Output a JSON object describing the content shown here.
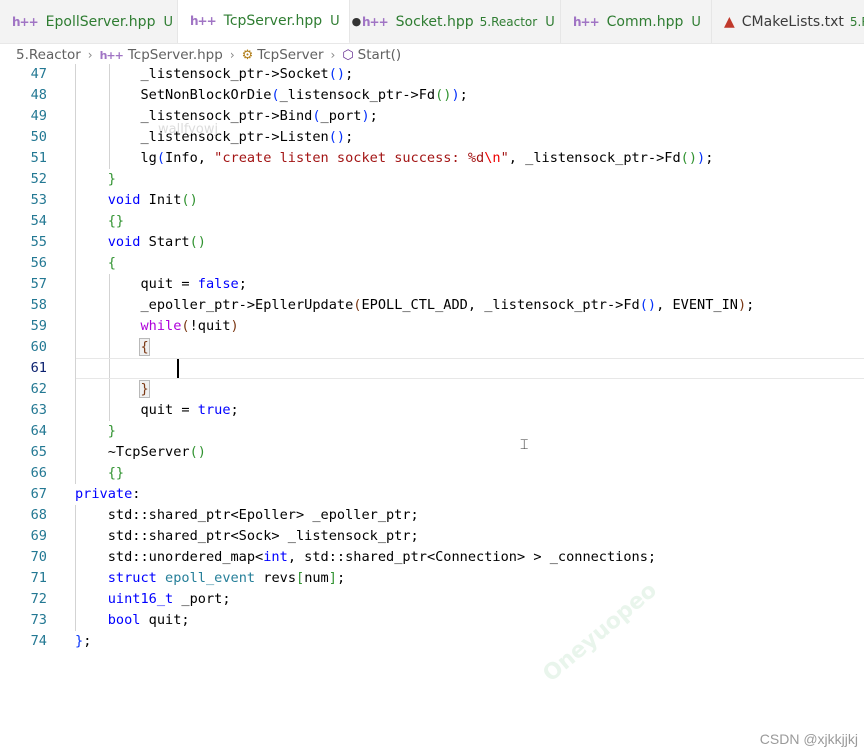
{
  "tabs": [
    {
      "name": "EpollServer.hpp",
      "status": "U",
      "active": false
    },
    {
      "name": "TcpServer.hpp",
      "status": "U",
      "active": true,
      "dirty": "●"
    },
    {
      "name": "Socket.hpp",
      "dir": "5.Reactor",
      "status": "U",
      "active": false
    },
    {
      "name": "Comm.hpp",
      "status": "U",
      "active": false
    },
    {
      "name": "CMakeLists.txt",
      "dir": "5.Re",
      "active": false
    }
  ],
  "breadcrumb": {
    "folder": "5.Reactor",
    "file": "TcpServer.hpp",
    "class": "TcpServer",
    "method": "Start()"
  },
  "editor": {
    "lines": [
      {
        "n": "47"
      },
      {
        "n": "48"
      },
      {
        "n": "49"
      },
      {
        "n": "50"
      },
      {
        "n": "51"
      },
      {
        "n": "52"
      },
      {
        "n": "53"
      },
      {
        "n": "54"
      },
      {
        "n": "55"
      },
      {
        "n": "56"
      },
      {
        "n": "57"
      },
      {
        "n": "58"
      },
      {
        "n": "59"
      },
      {
        "n": "60"
      },
      {
        "n": "61"
      },
      {
        "n": "62"
      },
      {
        "n": "63"
      },
      {
        "n": "64"
      },
      {
        "n": "65"
      },
      {
        "n": "66"
      },
      {
        "n": "67"
      },
      {
        "n": "68"
      },
      {
        "n": "69"
      },
      {
        "n": "70"
      },
      {
        "n": "71"
      },
      {
        "n": "72"
      },
      {
        "n": "73"
      },
      {
        "n": "74"
      }
    ],
    "ghost_text": "wallfyowj"
  },
  "watermark": {
    "text": "Oneyuopeo"
  },
  "credit": "CSDN @xjkkjjkj"
}
